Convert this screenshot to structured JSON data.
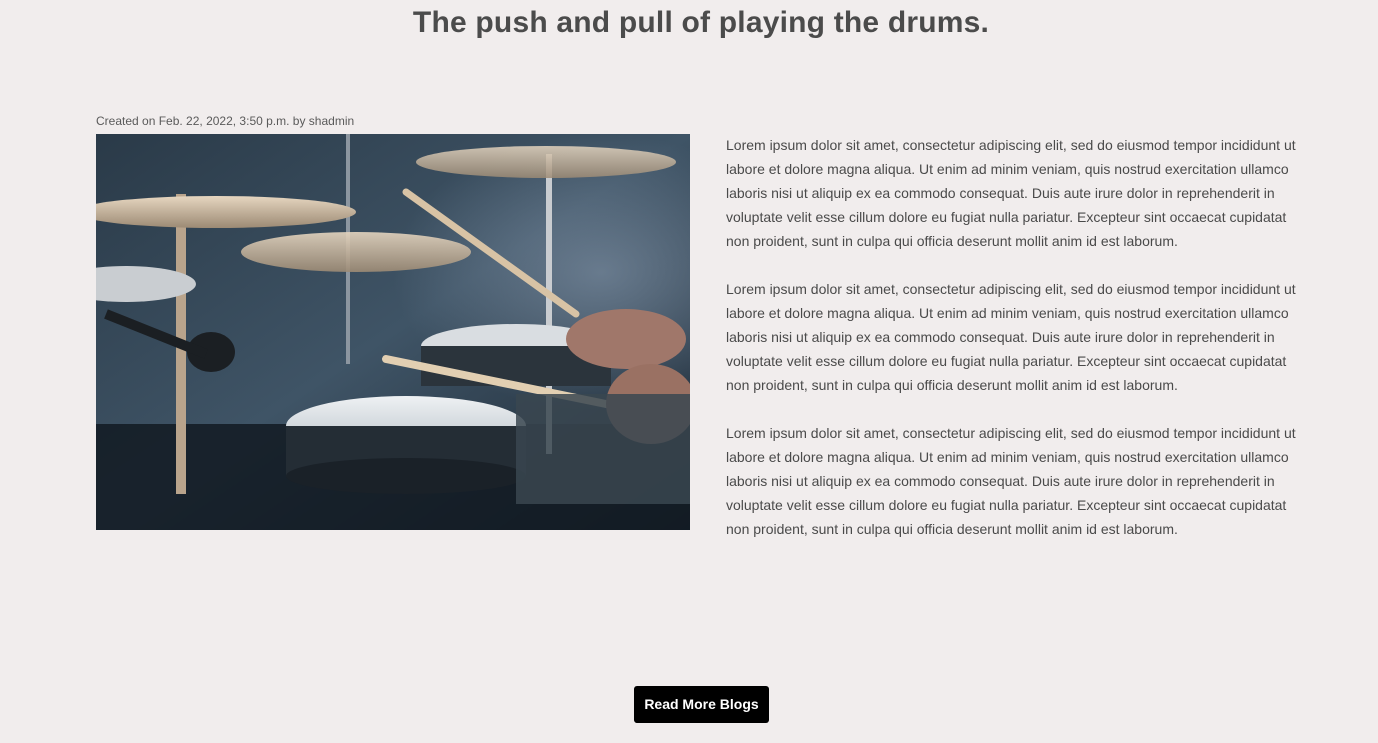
{
  "post": {
    "title": "The push and pull of playing the drums.",
    "meta": "Created on Feb. 22, 2022, 3:50 p.m. by shadmin",
    "paragraphs": [
      "Lorem ipsum dolor sit amet, consectetur adipiscing elit, sed do eiusmod tempor incididunt ut labore et dolore magna aliqua. Ut enim ad minim veniam, quis nostrud exercitation ullamco laboris nisi ut aliquip ex ea commodo consequat. Duis aute irure dolor in reprehenderit in voluptate velit esse cillum dolore eu fugiat nulla pariatur. Excepteur sint occaecat cupidatat non proident, sunt in culpa qui officia deserunt mollit anim id est laborum.",
      "Lorem ipsum dolor sit amet, consectetur adipiscing elit, sed do eiusmod tempor incididunt ut labore et dolore magna aliqua. Ut enim ad minim veniam, quis nostrud exercitation ullamco laboris nisi ut aliquip ex ea commodo consequat. Duis aute irure dolor in reprehenderit in voluptate velit esse cillum dolore eu fugiat nulla pariatur. Excepteur sint occaecat cupidatat non proident, sunt in culpa qui officia deserunt mollit anim id est laborum.",
      "Lorem ipsum dolor sit amet, consectetur adipiscing elit, sed do eiusmod tempor incididunt ut labore et dolore magna aliqua. Ut enim ad minim veniam, quis nostrud exercitation ullamco laboris nisi ut aliquip ex ea commodo consequat. Duis aute irure dolor in reprehenderit in voluptate velit esse cillum dolore eu fugiat nulla pariatur. Excepteur sint occaecat cupidatat non proident, sunt in culpa qui officia deserunt mollit anim id est laborum."
    ]
  },
  "read_more_label": "Read More Blogs",
  "colors": {
    "page_background": "#f1eded",
    "text": "#4a4a4a",
    "button_background": "#000000",
    "button_text": "#ffffff"
  }
}
